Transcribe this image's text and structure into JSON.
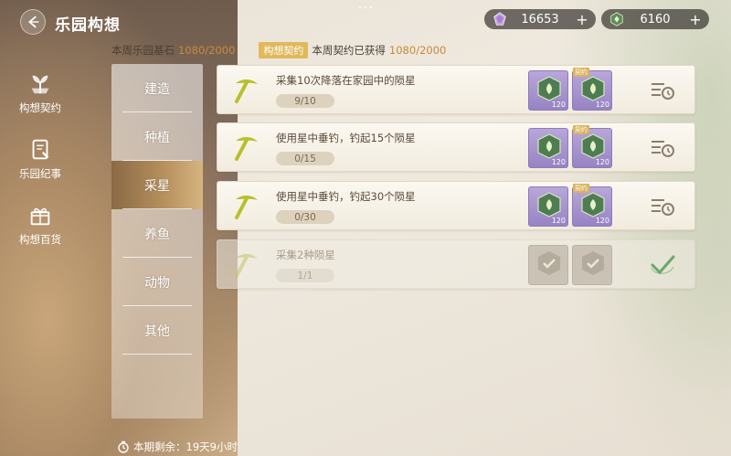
{
  "header": {
    "title": "乐园构想",
    "currencies": [
      {
        "icon": "purple-gem-icon",
        "value": "16653",
        "plus": "+"
      },
      {
        "icon": "green-star-icon",
        "value": "6160",
        "plus": "+"
      }
    ]
  },
  "info": {
    "weekly_stone_label": "本周乐园基石",
    "weekly_stone_value": "1080/2000",
    "tag": "构想契约",
    "contract_label": "本周契约已获得",
    "contract_value": "1080/2000"
  },
  "left_nav": [
    {
      "label": "构想契约",
      "icon": "plant-emblem-icon"
    },
    {
      "label": "乐园纪事",
      "icon": "journal-icon"
    },
    {
      "label": "构想百货",
      "icon": "gift-box-icon"
    }
  ],
  "categories": [
    {
      "label": "建造",
      "active": false
    },
    {
      "label": "种植",
      "active": false
    },
    {
      "label": "采星",
      "active": true
    },
    {
      "label": "养鱼",
      "active": false
    },
    {
      "label": "动物",
      "active": false
    },
    {
      "label": "其他",
      "active": false
    }
  ],
  "tasks": [
    {
      "title": "采集10次降落在家园中的陨星",
      "progress": "9/10",
      "rewards": [
        {
          "count": "120",
          "tag": ""
        },
        {
          "count": "120",
          "tag": "契约"
        }
      ],
      "state": "in-progress"
    },
    {
      "title": "使用星中垂钓，钓起15个陨星",
      "progress": "0/15",
      "rewards": [
        {
          "count": "120",
          "tag": ""
        },
        {
          "count": "120",
          "tag": "契约"
        }
      ],
      "state": "in-progress"
    },
    {
      "title": "使用星中垂钓，钓起30个陨星",
      "progress": "0/30",
      "rewards": [
        {
          "count": "120",
          "tag": ""
        },
        {
          "count": "120",
          "tag": "契约"
        }
      ],
      "state": "in-progress"
    },
    {
      "title": "采集2种陨星",
      "progress": "1/1",
      "rewards": [
        {
          "count": "",
          "tag": ""
        },
        {
          "count": "",
          "tag": ""
        }
      ],
      "state": "completed"
    }
  ],
  "timer": {
    "label": "本期剩余：19天9小时"
  },
  "colors": {
    "accent": "#c8893a",
    "tag_bg": "#e2b85c",
    "reward_bg": "#9783c2",
    "icon_green": "#b7c02c"
  }
}
